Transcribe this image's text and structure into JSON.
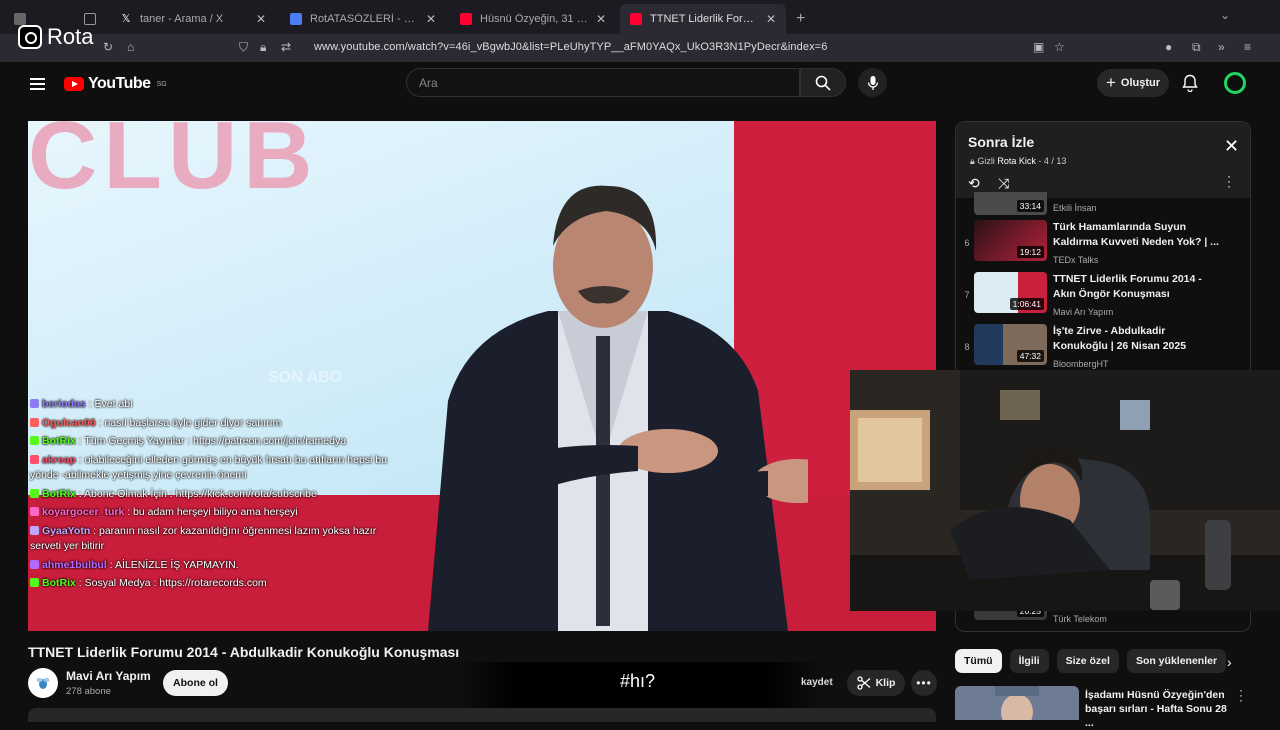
{
  "browser": {
    "tabs": [
      {
        "label": "",
        "favicon_color": "#666",
        "active": false
      },
      {
        "label": "taner - Arama / X",
        "favicon_color": "#ffffff",
        "active": false
      },
      {
        "label": "RotATASÖZLERİ - Google Dokü",
        "favicon_color": "#4a7ef0",
        "active": false
      },
      {
        "label": "Hüsnü Özyeğin, 31 Ocak 2017 P",
        "favicon_color": "#ff0033",
        "active": false
      },
      {
        "label": "TTNET Liderlik Forumu 2014 - A",
        "favicon_color": "#ff0033",
        "active": true
      }
    ],
    "new_tab": "+",
    "url": "www.youtube.com/watch?v=46i_vBgwbJ0&list=PLeUhyTYP__aFM0YAQx_UkO3R3N1PyDecr&index=6"
  },
  "overlay_logo": {
    "text": "Rota"
  },
  "youtube": {
    "logo_text": "YouTube",
    "region": "SG",
    "search_placeholder": "Ara",
    "create_label": "Oluştur",
    "brand_color": "#ff0000"
  },
  "video": {
    "title": "TTNET Liderlik Forumu 2014 - Abdulkadir Konukoğlu Konuşması",
    "backdrop_text": "CLUB",
    "watermark": "SON ABO",
    "channel": {
      "name": "Mavi Arı Yapım",
      "subs": "278 abone"
    },
    "subscribe_label": "Abone ol",
    "save_label": "kaydet",
    "clip_label": "Klip",
    "caption": "#hı?"
  },
  "chat": [
    {
      "user": "beriodas",
      "text": ": Evet abi",
      "color": "#8b7cf6"
    },
    {
      "user": "Ogulcan06",
      "text": ": nasıl başlarsa öyle gider diyor sanırım",
      "color": "#ff5c5c"
    },
    {
      "user": "BotRix",
      "text": ": Tüm Geçmiş Yayınlar : https://patreon.com/join/ramedya",
      "color": "#53fc18"
    },
    {
      "user": "akreap",
      "text": ": olabileceğini elleden görmüş en büyük fırsatı bu atıfların hepsi bu yönde -abilmekle yetişmiş yine çevrenin önemi",
      "color": "#ff4d6d"
    },
    {
      "user": "BotRix",
      "text": ": Abone Olmak İçin : https://kick.com/rota/subscribe",
      "color": "#53fc18"
    },
    {
      "user": "koyargocer_turk",
      "text": ": bu adam herşeyi biliyo ama herşeyi",
      "color": "#ff66cc"
    },
    {
      "user": "GyaaYotn",
      "text": ": paranın nasıl zor kazanıldığını öğrenmesi lazım yoksa hazır serveti yer bitirir",
      "color": "#c0a6ff"
    },
    {
      "user": "ahme1bulbul",
      "text": ": AİLENİZLE İŞ YAPMAYIN.",
      "color": "#b36bff"
    },
    {
      "user": "BotRix",
      "text": ": Sosyal Medya : https://rotarecords.com",
      "color": "#53fc18"
    }
  ],
  "playlist": {
    "title": "Sonra İzle",
    "privacy": "Gizli",
    "owner": "Rota Kick",
    "position": "4 / 13",
    "items": [
      {
        "index": "",
        "title": "",
        "channel": "Etkili İnsan",
        "duration": "33:14"
      },
      {
        "index": "6",
        "title": "Türk Hamamlarında Suyun Kaldırma Kuvveti Neden Yok? | ...",
        "channel": "TEDx Talks",
        "duration": "19:12"
      },
      {
        "index": "7",
        "title": "TTNET Liderlik Forumu 2014 - Akın Öngör Konuşması",
        "channel": "Mavi Arı Yapım",
        "duration": "1:06:41"
      },
      {
        "index": "8",
        "title": "İş'te Zirve - Abdulkadir Konukoğlu | 26 Nisan 2025",
        "channel": "BloombergHT",
        "duration": "47:32"
      }
    ],
    "bottom_channel": "Türk Telekom",
    "bottom_duration": "20:25"
  },
  "chips": [
    "Tümü",
    "İlgili",
    "Size özel",
    "Son yüklenenler"
  ],
  "recommended": {
    "title": "İşadamı Hüsnü Özyeğin'den başarı sırları - Hafta Sonu 28 ..."
  }
}
